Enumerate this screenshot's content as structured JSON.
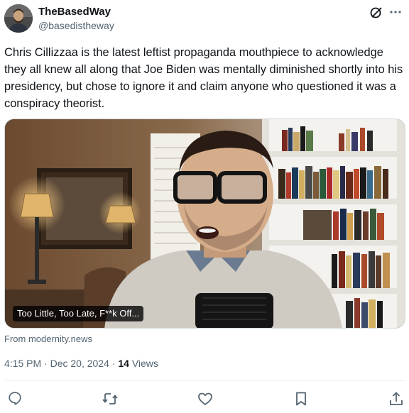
{
  "author": {
    "display_name": "TheBasedWay",
    "handle": "@basedistheway",
    "avatar_icon": "profile-photo"
  },
  "tweet": {
    "text": "Chris Cillizzaa is the latest leftist propaganda mouthpiece to acknowledge they all knew all along that Joe Biden was mentally diminished shortly into his presidency, but chose to ignore it and claim anyone who questioned it was a conspiracy theorist."
  },
  "media": {
    "caption": "Too Little, Too Late, F**k Off..."
  },
  "source": {
    "text": "From modernity.news"
  },
  "meta": {
    "time": "4:15 PM",
    "separator": "·",
    "date": "Dec 20, 2024",
    "views_count": "14",
    "views_label": "Views"
  },
  "actions": {
    "icons": [
      "reply-icon",
      "repost-icon",
      "like-icon",
      "bookmark-icon",
      "share-icon"
    ]
  },
  "colors": {
    "text_primary": "#0f1419",
    "text_secondary": "#536471",
    "border": "#cfd9de"
  }
}
